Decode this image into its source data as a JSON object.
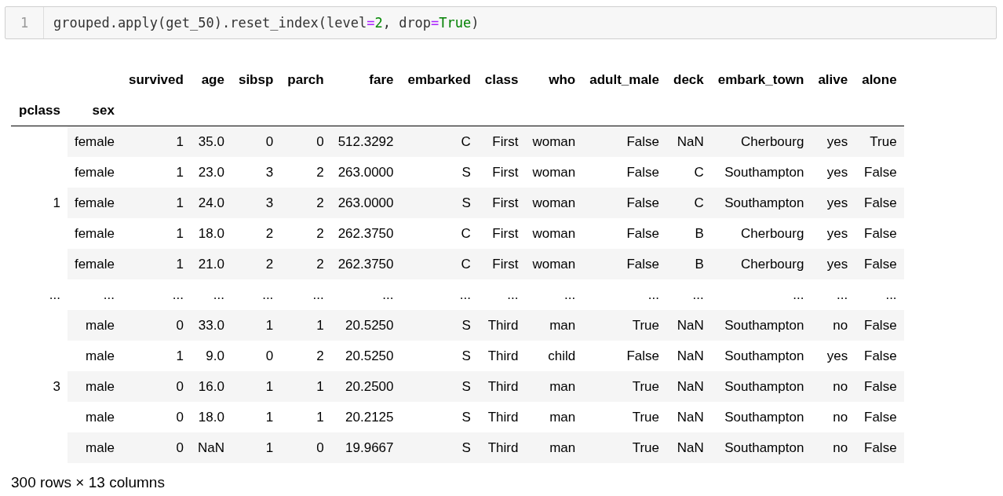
{
  "code_cell": {
    "line_number": "1",
    "tokens": [
      {
        "text": "grouped.apply(get_50).reset_index(level",
        "kind": "plain"
      },
      {
        "text": "=",
        "kind": "operator"
      },
      {
        "text": "2",
        "kind": "number"
      },
      {
        "text": ", drop",
        "kind": "plain"
      },
      {
        "text": "=",
        "kind": "operator"
      },
      {
        "text": "True",
        "kind": "keyword"
      },
      {
        "text": ")",
        "kind": "plain"
      }
    ]
  },
  "table": {
    "columns": [
      "survived",
      "age",
      "sibsp",
      "parch",
      "fare",
      "embarked",
      "class",
      "who",
      "adult_male",
      "deck",
      "embark_town",
      "alive",
      "alone"
    ],
    "index_names": [
      "pclass",
      "sex"
    ],
    "groups": [
      {
        "index": "1",
        "rows": [
          {
            "sex": "female",
            "values": [
              "1",
              "35.0",
              "0",
              "0",
              "512.3292",
              "C",
              "First",
              "woman",
              "False",
              "NaN",
              "Cherbourg",
              "yes",
              "True"
            ]
          },
          {
            "sex": "female",
            "values": [
              "1",
              "23.0",
              "3",
              "2",
              "263.0000",
              "S",
              "First",
              "woman",
              "False",
              "C",
              "Southampton",
              "yes",
              "False"
            ]
          },
          {
            "sex": "female",
            "values": [
              "1",
              "24.0",
              "3",
              "2",
              "263.0000",
              "S",
              "First",
              "woman",
              "False",
              "C",
              "Southampton",
              "yes",
              "False"
            ]
          },
          {
            "sex": "female",
            "values": [
              "1",
              "18.0",
              "2",
              "2",
              "262.3750",
              "C",
              "First",
              "woman",
              "False",
              "B",
              "Cherbourg",
              "yes",
              "False"
            ]
          },
          {
            "sex": "female",
            "values": [
              "1",
              "21.0",
              "2",
              "2",
              "262.3750",
              "C",
              "First",
              "woman",
              "False",
              "B",
              "Cherbourg",
              "yes",
              "False"
            ]
          }
        ]
      },
      {
        "index": "...",
        "rows": [
          {
            "sex": "...",
            "values": [
              "...",
              "...",
              "...",
              "...",
              "...",
              "...",
              "...",
              "...",
              "...",
              "...",
              "...",
              "...",
              "..."
            ]
          }
        ]
      },
      {
        "index": "3",
        "rows": [
          {
            "sex": "male",
            "values": [
              "0",
              "33.0",
              "1",
              "1",
              "20.5250",
              "S",
              "Third",
              "man",
              "True",
              "NaN",
              "Southampton",
              "no",
              "False"
            ]
          },
          {
            "sex": "male",
            "values": [
              "1",
              "9.0",
              "0",
              "2",
              "20.5250",
              "S",
              "Third",
              "child",
              "False",
              "NaN",
              "Southampton",
              "yes",
              "False"
            ]
          },
          {
            "sex": "male",
            "values": [
              "0",
              "16.0",
              "1",
              "1",
              "20.2500",
              "S",
              "Third",
              "man",
              "True",
              "NaN",
              "Southampton",
              "no",
              "False"
            ]
          },
          {
            "sex": "male",
            "values": [
              "0",
              "18.0",
              "1",
              "1",
              "20.2125",
              "S",
              "Third",
              "man",
              "True",
              "NaN",
              "Southampton",
              "no",
              "False"
            ]
          },
          {
            "sex": "male",
            "values": [
              "0",
              "NaN",
              "1",
              "0",
              "19.9667",
              "S",
              "Third",
              "man",
              "True",
              "NaN",
              "Southampton",
              "no",
              "False"
            ]
          }
        ]
      }
    ]
  },
  "footer": "300 rows × 13 columns"
}
